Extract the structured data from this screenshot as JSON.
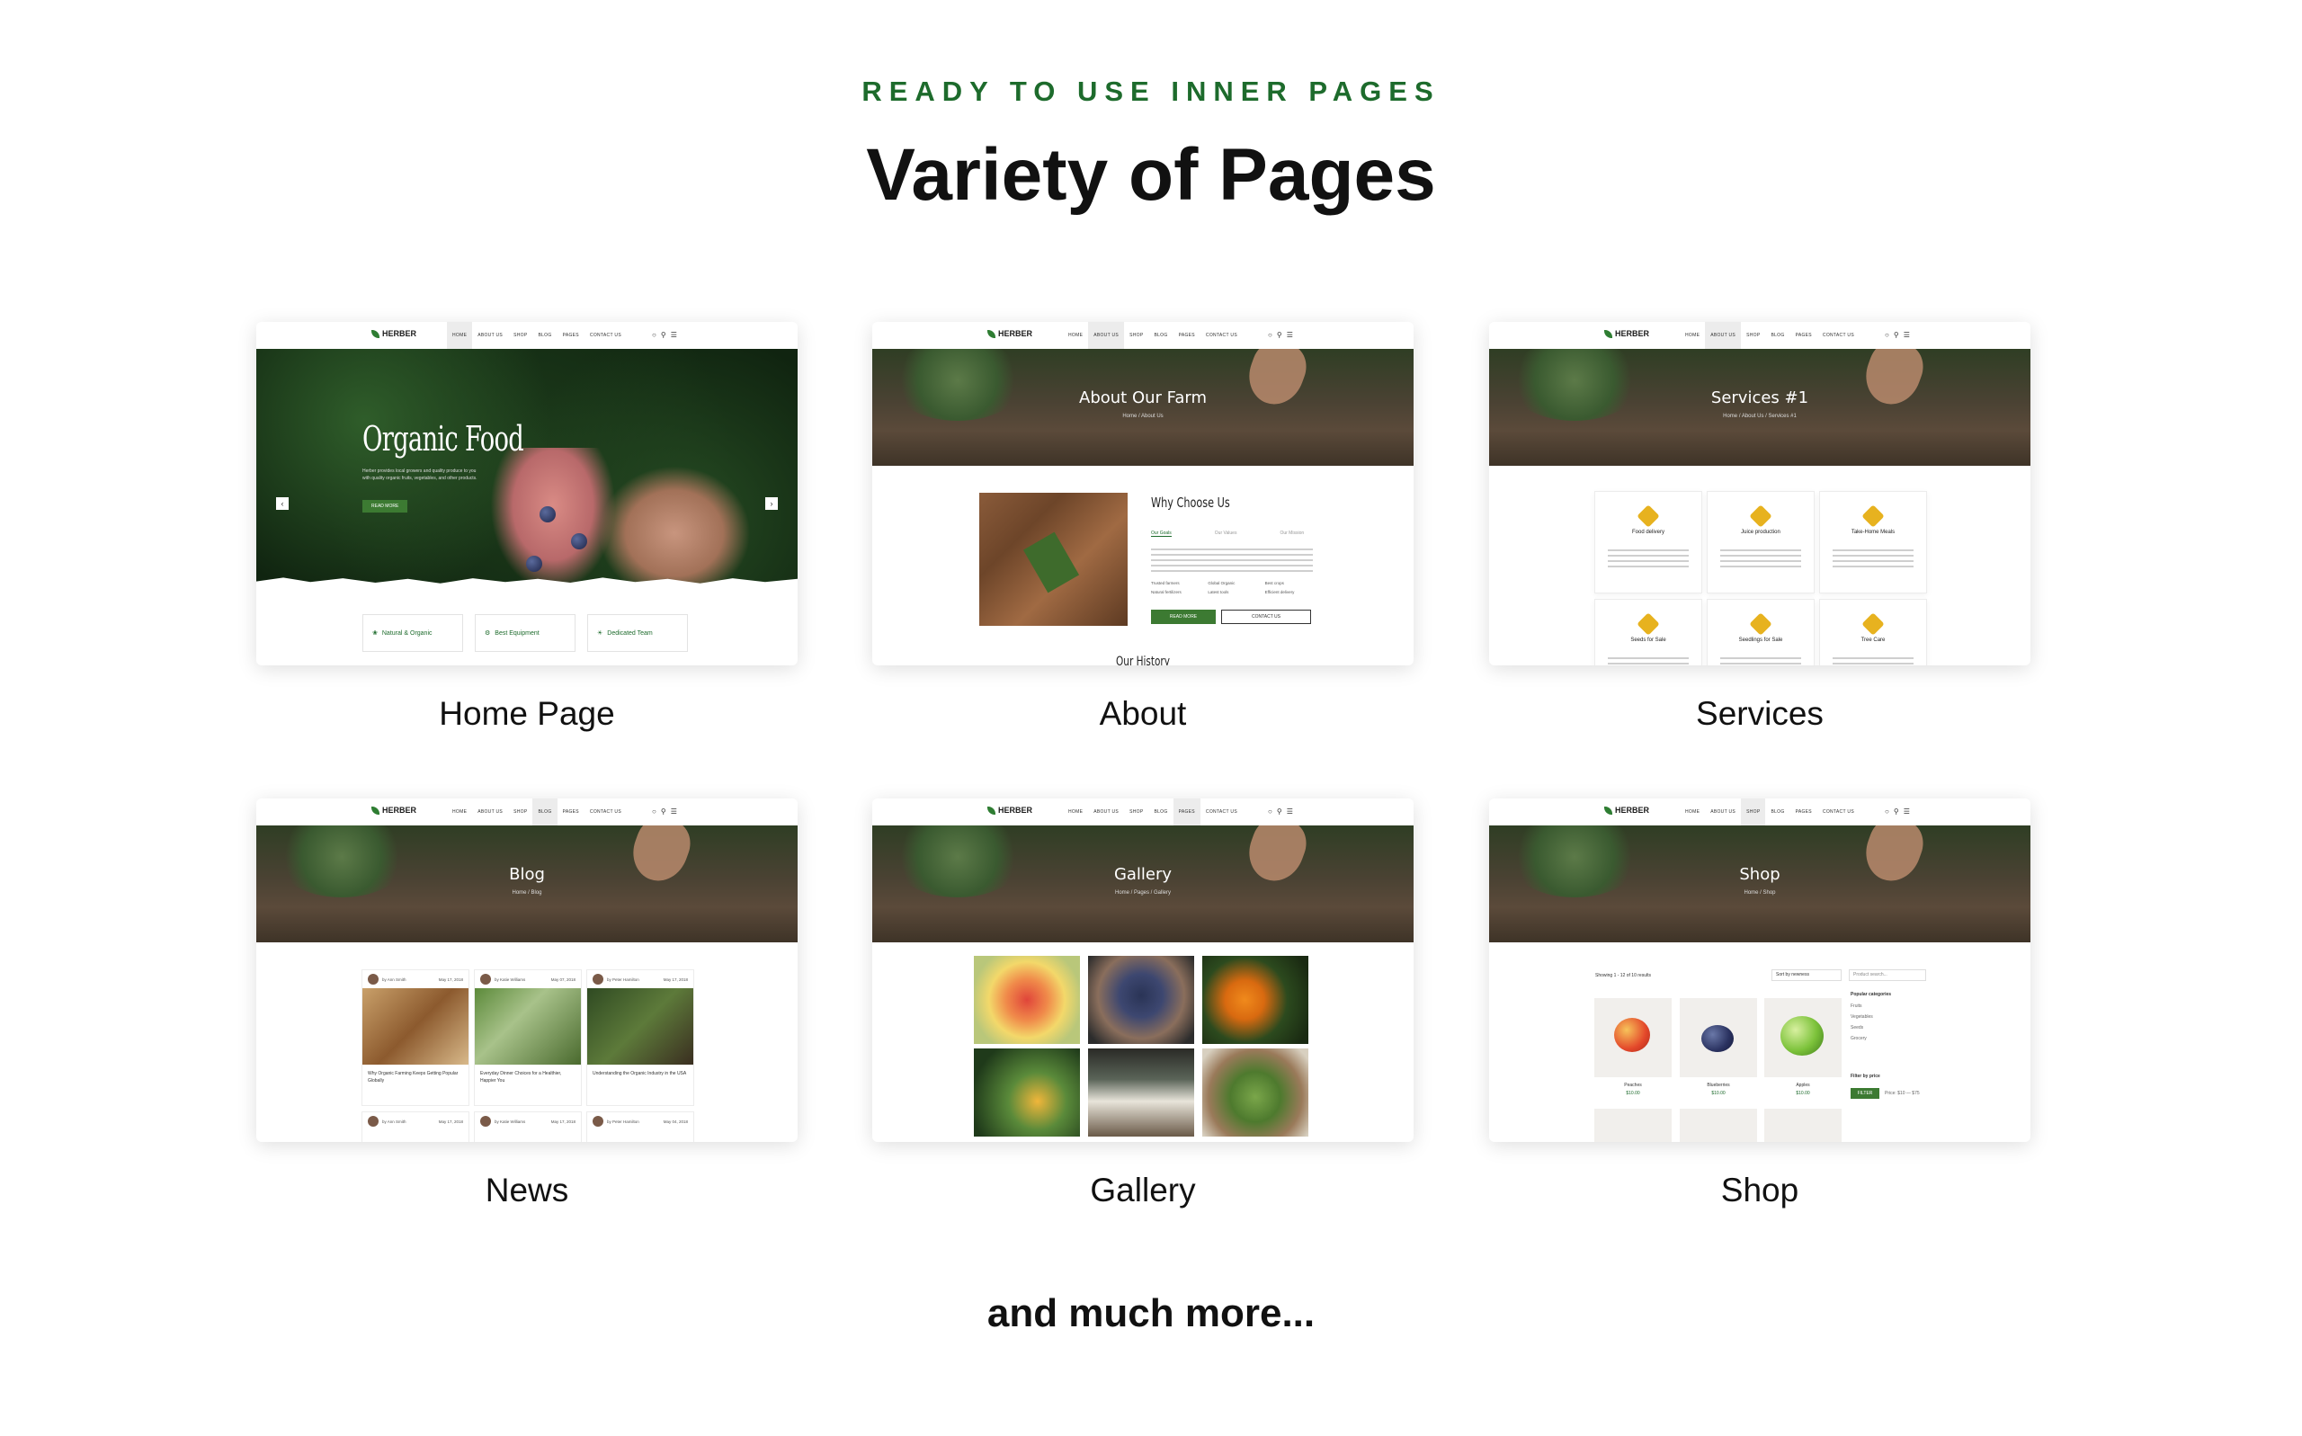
{
  "header": {
    "eyebrow": "READY TO USE INNER PAGES",
    "title": "Variety of Pages"
  },
  "footer": {
    "more": "and much more..."
  },
  "brand": {
    "name": "HERBER",
    "accent": "#1d6b2c"
  },
  "cards": [
    {
      "label": "Home Page",
      "menu": [
        "HOME",
        "ABOUT US",
        "SHOP",
        "BLOG",
        "PAGES",
        "CONTACT US"
      ],
      "hero_title": "Organic Food",
      "hero_text": "Herber provides local growers and quality produce to you with quality organic fruits, vegetables, and other products.",
      "hero_button": "READ MORE",
      "features": [
        "Natural & Organic",
        "Best Equipment",
        "Dedicated Team"
      ]
    },
    {
      "label": "About",
      "menu": [
        "HOME",
        "ABOUT US",
        "SHOP",
        "BLOG",
        "PAGES",
        "CONTACT US"
      ],
      "hero_title": "About Our Farm",
      "crumb": "Home  /  About Us",
      "section_title": "Why Choose Us",
      "tabs": [
        "Our Goals",
        "Our Values",
        "Our Mission"
      ],
      "checks": [
        "Trusted farmers",
        "Global Organic",
        "Best crops",
        "Natural fertilizers",
        "Latest tools",
        "Efficient delivery"
      ],
      "buttons": [
        "READ MORE",
        "CONTACT US"
      ],
      "history": "Our History"
    },
    {
      "label": "Services",
      "menu": [
        "HOME",
        "ABOUT US",
        "SHOP",
        "BLOG",
        "PAGES",
        "CONTACT US"
      ],
      "hero_title": "Services #1",
      "crumb": "Home  /  About Us  /  Services #1",
      "services": [
        "Food delivery",
        "Juice production",
        "Take-Home Meals",
        "Seeds for Sale",
        "Seedlings for Sale",
        "Tree Care"
      ]
    },
    {
      "label": "News",
      "menu": [
        "HOME",
        "ABOUT US",
        "SHOP",
        "BLOG",
        "PAGES",
        "CONTACT US"
      ],
      "hero_title": "Blog",
      "crumb": "Home  /  Blog",
      "posts": [
        {
          "author": "by Ann Smith",
          "date": "May 17, 2018",
          "title": "Why Organic Farming Keeps Getting Popular Globally"
        },
        {
          "author": "by Katie Williams",
          "date": "May 07, 2018",
          "title": "Everyday Dinner Choices for a Healthier, Happier You"
        },
        {
          "author": "by Peter Hamilton",
          "date": "May 17, 2018",
          "title": "Understanding the Organic Industry in the USA"
        }
      ],
      "posts_row2": [
        {
          "author": "by Ann Smith",
          "date": "May 17, 2018"
        },
        {
          "author": "by Katie Williams",
          "date": "May 17, 2018"
        },
        {
          "author": "by Peter Hamilton",
          "date": "May 04, 2018"
        }
      ]
    },
    {
      "label": "Gallery",
      "menu": [
        "HOME",
        "ABOUT US",
        "SHOP",
        "BLOG",
        "PAGES",
        "CONTACT US"
      ],
      "hero_title": "Gallery",
      "crumb": "Home  /  Pages  /  Gallery"
    },
    {
      "label": "Shop",
      "menu": [
        "HOME",
        "ABOUT US",
        "SHOP",
        "BLOG",
        "PAGES",
        "CONTACT US"
      ],
      "hero_title": "Shop",
      "crumb": "Home  /  Shop",
      "results": "Showing 1 - 12 of 10 results",
      "sort": "Sort by newness",
      "search_placeholder": "Product search...",
      "categories_title": "Popular categories",
      "categories": [
        "Fruits",
        "Vegetables",
        "Seeds",
        "Grocery"
      ],
      "price_title": "Filter by price",
      "filter_button": "FILTER",
      "price_range": "Price: $10 — $75",
      "products": [
        {
          "name": "Peaches",
          "price": "$10.00"
        },
        {
          "name": "Blueberries",
          "price": "$10.00"
        },
        {
          "name": "Apples",
          "price": "$10.00"
        }
      ]
    }
  ]
}
